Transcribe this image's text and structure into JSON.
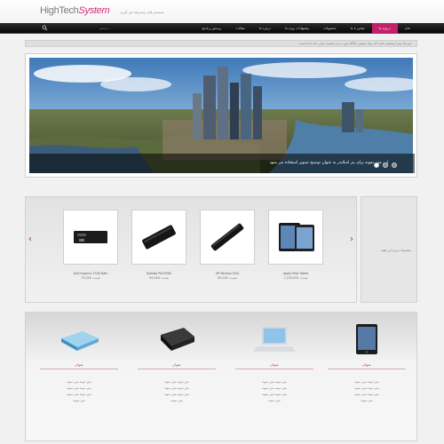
{
  "header": {
    "logo_part1": "HighTech",
    "logo_part2": "System",
    "tagline": "سیستم های پیشرفته فن آوری"
  },
  "nav": {
    "search_placeholder": "جستجو...",
    "items": [
      {
        "label": "خانه",
        "active": false
      },
      {
        "label": "درباره ما",
        "active": true
      },
      {
        "label": "تماس با ما",
        "active": false
      },
      {
        "label": "محصولات",
        "active": false
      },
      {
        "label": "پیشنهادات ویژه ما",
        "active": false
      },
      {
        "label": "درباره ما",
        "active": false
      },
      {
        "label": "مقالات",
        "active": false
      },
      {
        "label": "پرسش و پاسخ",
        "active": false
      }
    ]
  },
  "breadcrumb": "این یک متن آزمایشی است که برای نمایش جایگاه متن در این قسمت قرار داده شده است",
  "banner": {
    "caption": "این متن نمونه برای بنر اسلایدر به عنوان توضیح تصویر استفاده می شود",
    "active_dot": 0,
    "dots": 3
  },
  "products": [
    {
      "name": "Dell Inspiron 1545 Batt",
      "price": "قیمت: 79,000",
      "icon": "laptop-battery-icon"
    },
    {
      "name": "Toshiba PA3399U",
      "price": "قیمت: 85,000",
      "icon": "laptop-battery-icon"
    },
    {
      "name": "HP Pavilion DV4",
      "price": "قیمت: 69,000",
      "icon": "laptop-battery-icon"
    },
    {
      "name": "Apple iPad Tablet",
      "price": "قیمت: 1,230,000",
      "icon": "tablet-icon"
    }
  ],
  "side_box_text": "محصولات ویژه این هفته",
  "features": [
    {
      "title": "عنوان",
      "icon": "external-drive-icon",
      "lines": [
        "متن نمونه متن نمونه",
        "متن نمونه متن نمونه",
        "متن نمونه متن نمونه",
        "متن نمونه"
      ]
    },
    {
      "title": "عنوان",
      "icon": "hard-drive-icon",
      "lines": [
        "متن نمونه متن نمونه",
        "متن نمونه متن نمونه",
        "متن نمونه متن نمونه",
        "متن نمونه"
      ]
    },
    {
      "title": "عنوان",
      "icon": "laptop-icon",
      "lines": [
        "متن نمونه متن نمونه",
        "متن نمونه متن نمونه",
        "متن نمونه متن نمونه",
        "متن نمونه"
      ]
    },
    {
      "title": "عنوان",
      "icon": "tablet-icon",
      "lines": [
        "متن نمونه متن نمونه",
        "متن نمونه متن نمونه",
        "متن نمونه متن نمونه",
        "متن نمونه"
      ]
    }
  ],
  "colors": {
    "accent": "#c41f6b",
    "nav_bg": "#111111",
    "page_bg": "#f1f1f1"
  }
}
